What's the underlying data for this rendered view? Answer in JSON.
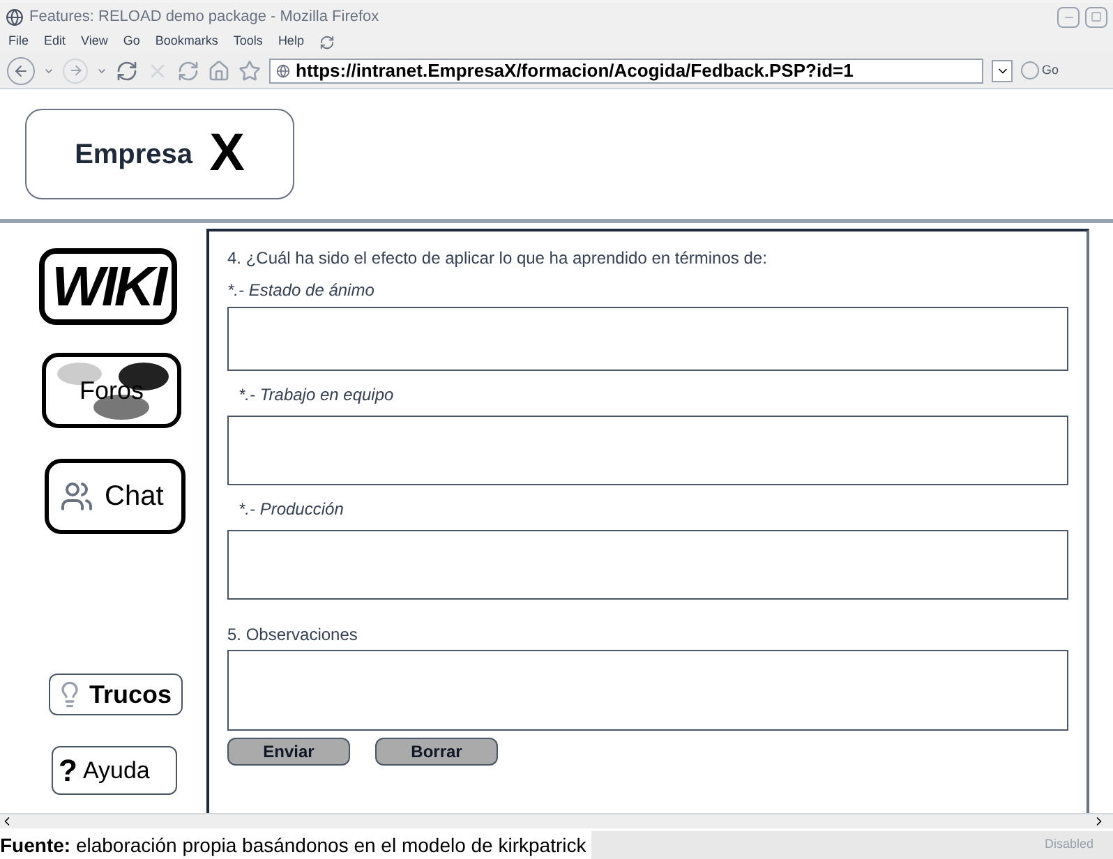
{
  "window": {
    "title": "Features: RELOAD demo package - Mozilla Firefox"
  },
  "menu": [
    "File",
    "Edit",
    "View",
    "Go",
    "Bookmarks",
    "Tools",
    "Help"
  ],
  "address_bar": {
    "value": "https://intranet.EmpresaX/formacion/Acogida/Fedback.PSP?id=1",
    "go": "Go"
  },
  "logo": {
    "name": "Empresa",
    "letter": "X"
  },
  "sidebar": [
    {
      "kind": "wiki",
      "label": "WIKI"
    },
    {
      "kind": "forum",
      "label": "Foros"
    },
    {
      "kind": "chat",
      "label": "Chat"
    },
    {
      "kind": "tips",
      "label": "Trucos"
    },
    {
      "kind": "help",
      "mark": "?",
      "label": "Ayuda"
    }
  ],
  "form": {
    "question": "4. ¿Cuál ha sido el efecto de aplicar lo que ha aprendido en términos de:",
    "items": [
      {
        "kind": "sub",
        "label": "*.- Estado de ánimo"
      },
      {
        "kind": "sub",
        "label": "*.- Trabajo en equipo"
      },
      {
        "kind": "sub",
        "label": "*.- Producción"
      },
      {
        "kind": "main",
        "label": "5. Observaciones"
      }
    ],
    "buttons": [
      "Enviar",
      "Borrar"
    ]
  },
  "status_bar": {
    "text": "Disabled"
  },
  "caption": "**Fuente:** elaboración propia basándonos en el modelo de kirkpatrick"
}
